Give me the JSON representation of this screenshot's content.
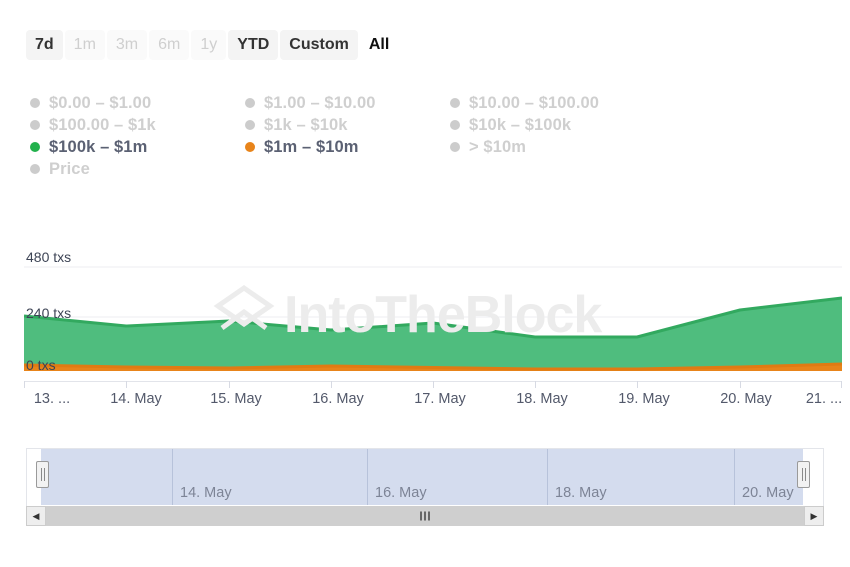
{
  "range_selector": {
    "buttons": [
      {
        "label": "7d",
        "state": "enabled"
      },
      {
        "label": "1m",
        "state": "disabled"
      },
      {
        "label": "3m",
        "state": "disabled"
      },
      {
        "label": "6m",
        "state": "disabled"
      },
      {
        "label": "1y",
        "state": "disabled"
      },
      {
        "label": "YTD",
        "state": "enabled"
      },
      {
        "label": "Custom",
        "state": "enabled"
      },
      {
        "label": "All",
        "state": "selected"
      }
    ]
  },
  "legend": {
    "rows": [
      [
        {
          "label": "$0.00 – $1.00",
          "color": "#cccccc",
          "active": false
        },
        {
          "label": "$1.00 – $10.00",
          "color": "#cccccc",
          "active": false
        },
        {
          "label": "$10.00 – $100.00",
          "color": "#cccccc",
          "active": false
        }
      ],
      [
        {
          "label": "$100.00 – $1k",
          "color": "#cccccc",
          "active": false
        },
        {
          "label": "$1k – $10k",
          "color": "#cccccc",
          "active": false
        },
        {
          "label": "$10k – $100k",
          "color": "#cccccc",
          "active": false
        }
      ],
      [
        {
          "label": "$100k – $1m",
          "color": "#22b14c",
          "active": true
        },
        {
          "label": "$1m – $10m",
          "color": "#e8841a",
          "active": true
        },
        {
          "label": "> $10m",
          "color": "#cccccc",
          "active": false
        }
      ],
      [
        {
          "label": "Price",
          "color": "#cccccc",
          "active": false
        }
      ]
    ]
  },
  "chart_data": {
    "type": "area",
    "title": "",
    "xlabel": "",
    "ylabel": "txs",
    "ylim": [
      0,
      480
    ],
    "ytick_labels": [
      "0 txs",
      "240 txs",
      "480 txs"
    ],
    "ytick_values": [
      0,
      240,
      480
    ],
    "grid": true,
    "legend_position": "top",
    "watermark": "IntoTheBlock",
    "x_tick_labels": [
      "13. ...",
      "14. May",
      "15. May",
      "16. May",
      "17. May",
      "18. May",
      "19. May",
      "20. May",
      "21. ..."
    ],
    "x": [
      "13. May",
      "14. May",
      "15. May",
      "16. May",
      "17. May",
      "18. May",
      "19. May",
      "20. May",
      "21. May"
    ],
    "series": [
      {
        "name": "$100k – $1m",
        "color": "#4fbd7e",
        "line_color": "#32a95f",
        "values": [
          245,
          200,
          225,
          180,
          215,
          145,
          145,
          275,
          330
        ]
      },
      {
        "name": "$1m – $10m",
        "color": "#e8841a",
        "line_color": "#e07b13",
        "values": [
          22,
          16,
          14,
          20,
          15,
          10,
          10,
          16,
          24
        ]
      }
    ]
  },
  "navigator": {
    "labels": [
      {
        "text": "14. May",
        "x_pct": 17.5
      },
      {
        "text": "16. May",
        "x_pct": 42.0
      },
      {
        "text": "18. May",
        "x_pct": 64.5
      },
      {
        "text": "20. May",
        "x_pct": 88.0
      }
    ],
    "separators_pct": [
      16.5,
      41.0,
      63.5,
      87.0
    ],
    "handle_left_label": "navigator-handle-left",
    "handle_right_label": "navigator-handle-right"
  },
  "scrollbar": {
    "left_arrow": "◀",
    "right_arrow": "▶"
  }
}
